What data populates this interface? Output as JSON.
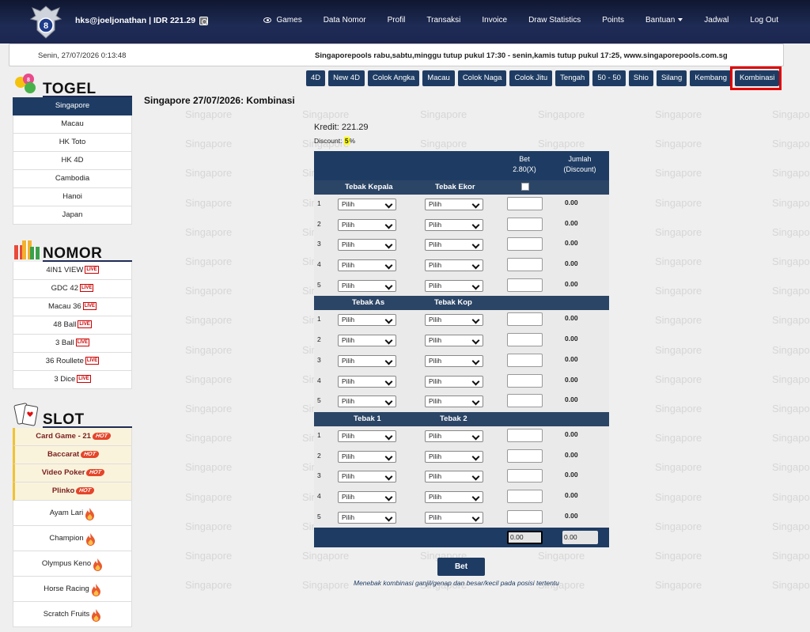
{
  "header": {
    "user": "hks@joeljonathan | IDR 221.29",
    "nav": [
      "Games",
      "Data Nomor",
      "Profil",
      "Transaksi",
      "Invoice",
      "Draw Statistics",
      "Points",
      "Bantuan",
      "Jadwal",
      "Log Out"
    ]
  },
  "infobar": {
    "date": "Senin, 27/07/2026 0:13:48",
    "message": "Singaporepools rabu,sabtu,minggu tutup pukul 17:30 - senin,kamis tutup pukul 17:25, www.singaporepools.com.sg"
  },
  "sidebar": {
    "togel_title": "TOGEL",
    "togel": [
      "Singapore",
      "Macau",
      "HK Toto",
      "HK 4D",
      "Cambodia",
      "Hanoi",
      "Japan"
    ],
    "nomor_title": "NOMOR",
    "nomor": [
      "4IN1 VIEW",
      "GDC 42",
      "Macau 36",
      "48 Ball",
      "3 Ball",
      "36 Roullete",
      "3 Dice"
    ],
    "live_label": "LIVE",
    "slot_title": "SLOT",
    "slot_hot": [
      "Card Game - 21",
      "Baccarat",
      "Video Poker",
      "Plinko"
    ],
    "hot_label": "HOT",
    "slot_other": [
      "Ayam Lari",
      "Champion",
      "Olympus Keno",
      "Horse Racing",
      "Scratch Fruits"
    ]
  },
  "tabs": [
    "4D",
    "New 4D",
    "Colok Angka",
    "Macau",
    "Colok Naga",
    "Colok Jitu",
    "Tengah",
    "50 - 50",
    "Shio",
    "Silang",
    "Kembang",
    "Kombinasi"
  ],
  "active_tab": "Kombinasi",
  "page_title": "Singapore 27/07/2026: Kombinasi",
  "credit": "Kredit: 221.29",
  "discount_label": "Discount:",
  "discount_value": "5",
  "discount_unit": "%",
  "watermark_text": "Singapore",
  "table": {
    "bet_header": [
      "Bet",
      "2.80(X)"
    ],
    "jumlah_header": [
      "Jumlah",
      "(Discount)"
    ],
    "groups": [
      {
        "left": "Tebak Kepala",
        "right": "Tebak Ekor"
      },
      {
        "left": "Tebak As",
        "right": "Tebak Kop"
      },
      {
        "left": "Tebak 1",
        "right": "Tebak 2"
      }
    ],
    "row_numbers": [
      "1",
      "2",
      "3",
      "4",
      "5"
    ],
    "select_default": "Pilih",
    "row_amount": "0.00",
    "total_bet": "0.00",
    "total_amount": "0.00"
  },
  "bet_button": "Bet",
  "note": "Menebak kombinasi ganjil/genap dan besar/kecil pada posisi tertentu",
  "colors": {
    "navy": "#1e3c63",
    "header": "#1e2b55",
    "highlight": "#e10000"
  }
}
